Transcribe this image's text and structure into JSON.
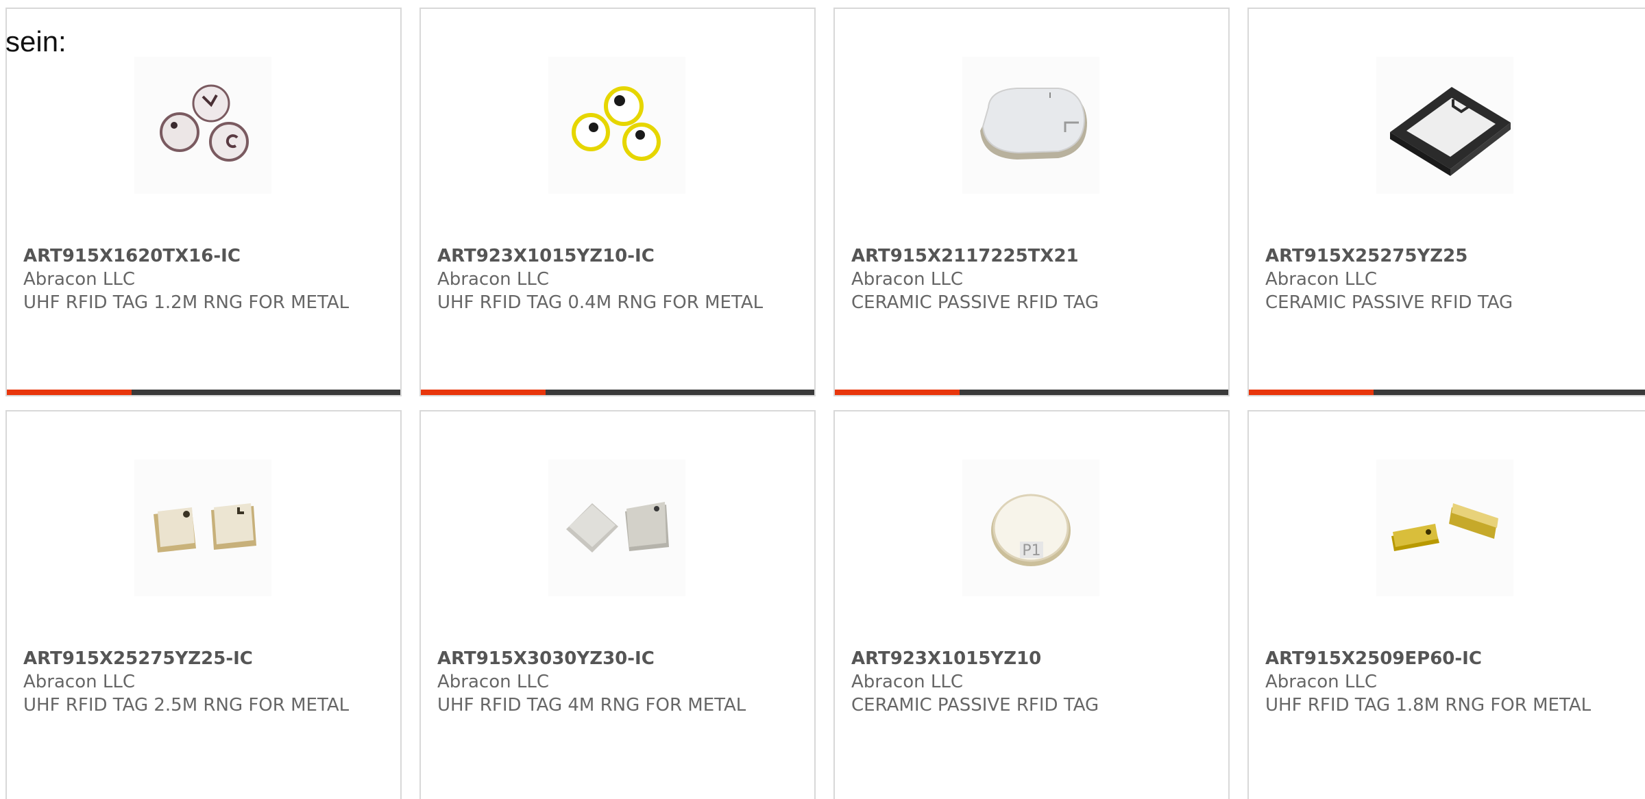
{
  "intro_text": "sein:",
  "colors": {
    "accent": "#e8360c",
    "bar": "#3a3a3a",
    "card_border": "#d8d8d8",
    "text": "#666666"
  },
  "products": [
    {
      "part_number": "ART915X1620TX16-IC",
      "manufacturer": "Abracon LLC",
      "description": "UHF RFID TAG 1.2M RNG FOR METAL",
      "image_icon": "round-rfid-tags-icon"
    },
    {
      "part_number": "ART923X1015YZ10-IC",
      "manufacturer": "Abracon LLC",
      "description": "UHF RFID TAG 0.4M RNG FOR METAL",
      "image_icon": "yellow-round-rfid-tags-icon"
    },
    {
      "part_number": "ART915X2117225TX21",
      "manufacturer": "Abracon LLC",
      "description": "CERAMIC PASSIVE RFID TAG",
      "image_icon": "oval-ceramic-tag-icon"
    },
    {
      "part_number": "ART915X25275YZ25",
      "manufacturer": "Abracon LLC",
      "description": "CERAMIC PASSIVE RFID TAG",
      "image_icon": "square-black-tag-icon"
    },
    {
      "part_number": "ART915X25275YZ25-IC",
      "manufacturer": "Abracon LLC",
      "description": "UHF RFID TAG 2.5M RNG FOR METAL",
      "image_icon": "square-gold-tags-icon"
    },
    {
      "part_number": "ART915X3030YZ30-IC",
      "manufacturer": "Abracon LLC",
      "description": "UHF RFID TAG 4M RNG FOR METAL",
      "image_icon": "square-silver-tags-icon"
    },
    {
      "part_number": "ART923X1015YZ10",
      "manufacturer": "Abracon LLC",
      "description": "CERAMIC PASSIVE RFID TAG",
      "image_icon": "round-ceramic-tag-icon"
    },
    {
      "part_number": "ART915X2509EP60-IC",
      "manufacturer": "Abracon LLC",
      "description": "UHF RFID TAG 1.8M RNG FOR METAL",
      "image_icon": "rectangular-gold-tags-icon"
    }
  ]
}
